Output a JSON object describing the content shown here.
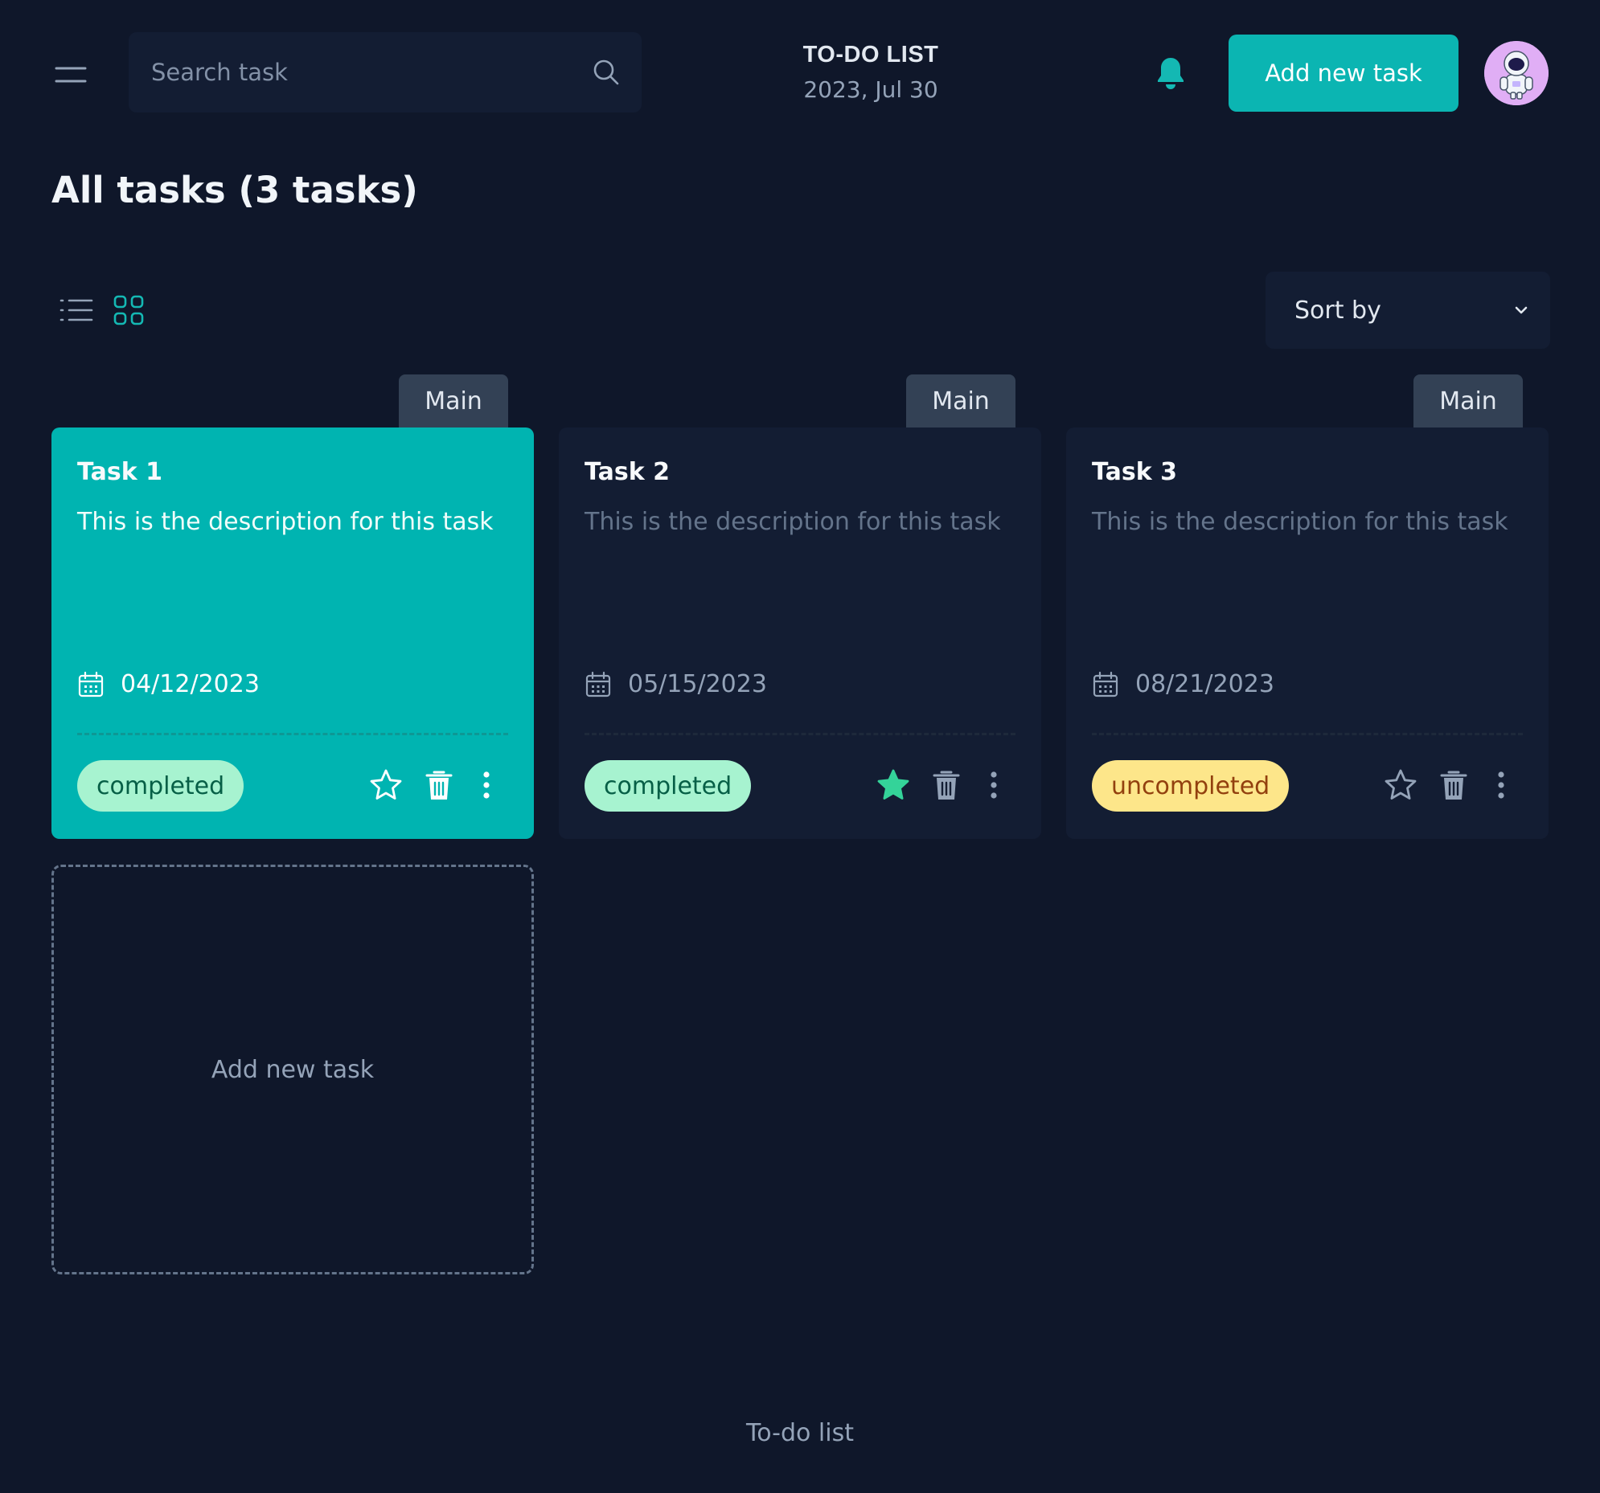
{
  "header": {
    "search_placeholder": "Search task",
    "app_title": "TO-DO LIST",
    "date": "2023, Jul 30",
    "add_button": "Add new task",
    "icons": [
      "menu-icon",
      "search-icon",
      "bell-icon",
      "avatar-astronaut"
    ]
  },
  "main": {
    "title": "All tasks (3 tasks)",
    "view_icons": [
      "list-view-icon",
      "grid-view-icon"
    ],
    "sort_label": "Sort by",
    "add_card_label": "Add new task"
  },
  "tasks": [
    {
      "tag": "Main",
      "title": "Task 1",
      "description": "This is the description for this task",
      "date": "04/12/2023",
      "status": "completed",
      "starred": false,
      "highlighted": true
    },
    {
      "tag": "Main",
      "title": "Task 2",
      "description": "This is the description for this task",
      "date": "05/15/2023",
      "status": "completed",
      "starred": true,
      "highlighted": false
    },
    {
      "tag": "Main",
      "title": "Task 3",
      "description": "This is the description for this task",
      "date": "08/21/2023",
      "status": "uncompleted",
      "starred": false,
      "highlighted": false
    }
  ],
  "footer": {
    "text": "To-do list"
  },
  "colors": {
    "background": "#0f172a",
    "surface": "#131d33",
    "accent": "#00b4b1",
    "tag": "#334155",
    "completed_bg": "#a7f3d0",
    "completed_text": "#065f46",
    "uncompleted_bg": "#fde68a",
    "uncompleted_text": "#92400e",
    "star_filled": "#34d399"
  }
}
